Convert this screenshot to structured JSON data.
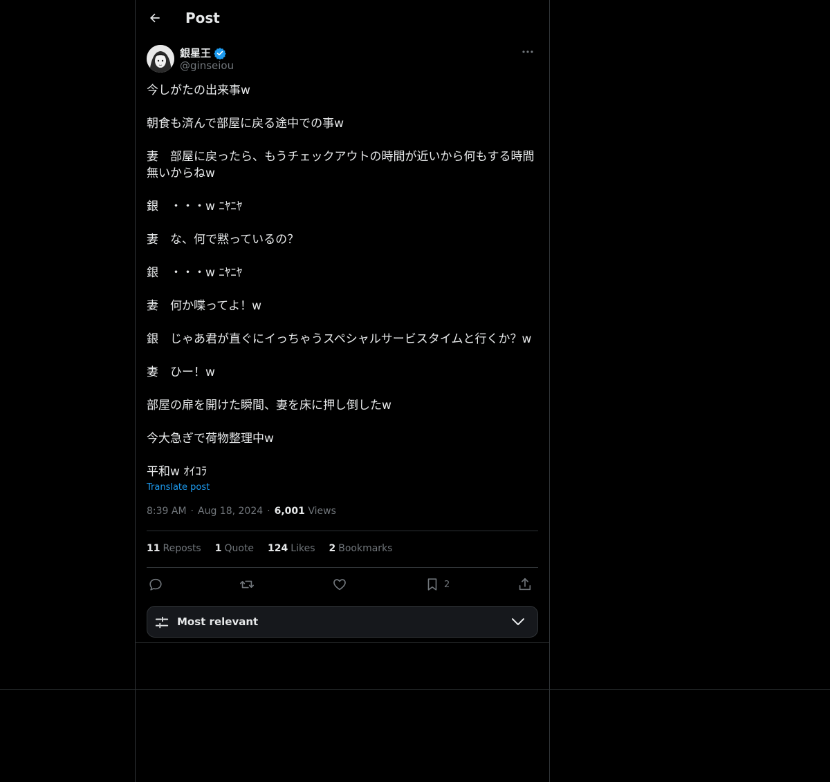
{
  "header": {
    "title": "Post"
  },
  "author": {
    "display_name": "銀星王",
    "handle": "@ginseiou",
    "verified": true,
    "verified_color": "#1d9bf0"
  },
  "post": {
    "paragraphs": [
      "今しがたの出来事w",
      "朝食も済んで部屋に戻る途中での事w",
      "妻　部屋に戻ったら、もうチェックアウトの時間が近いから何もする時間無いからねw",
      "銀　・・・w ﾆﾔﾆﾔ",
      "妻　な、何で黙っているの？",
      "銀　・・・w ﾆﾔﾆﾔ",
      "妻　何か喋ってよ！w",
      "銀　じゃあ君が直ぐにイっちゃうスペシャルサービスタイムと行くか？w",
      "妻　ひー！w",
      "部屋の扉を開けた瞬間、妻を床に押し倒したw",
      "今大急ぎで荷物整理中w",
      "平和w ｵｲｺﾗ"
    ],
    "translate_label": "Translate post",
    "time": "8:39 AM",
    "date": "Aug 18, 2024",
    "dot": "·",
    "views_count": "6,001",
    "views_label": "Views"
  },
  "stats": {
    "reposts_count": "11",
    "reposts_label": "Reposts",
    "quote_count": "1",
    "quote_label": "Quote",
    "likes_count": "124",
    "likes_label": "Likes",
    "bookmarks_count": "2",
    "bookmarks_label": "Bookmarks"
  },
  "actions": {
    "reply_icon": "reply-icon",
    "repost_icon": "repost-icon",
    "like_icon": "heart-icon",
    "bookmark_icon": "bookmark-icon",
    "bookmark_count": "2",
    "share_icon": "share-icon"
  },
  "sort": {
    "label": "Most relevant"
  },
  "colors": {
    "background": "#000000",
    "text": "#e7e9ea",
    "muted": "#71767b",
    "border": "#2f3336",
    "link": "#1d9bf0"
  }
}
